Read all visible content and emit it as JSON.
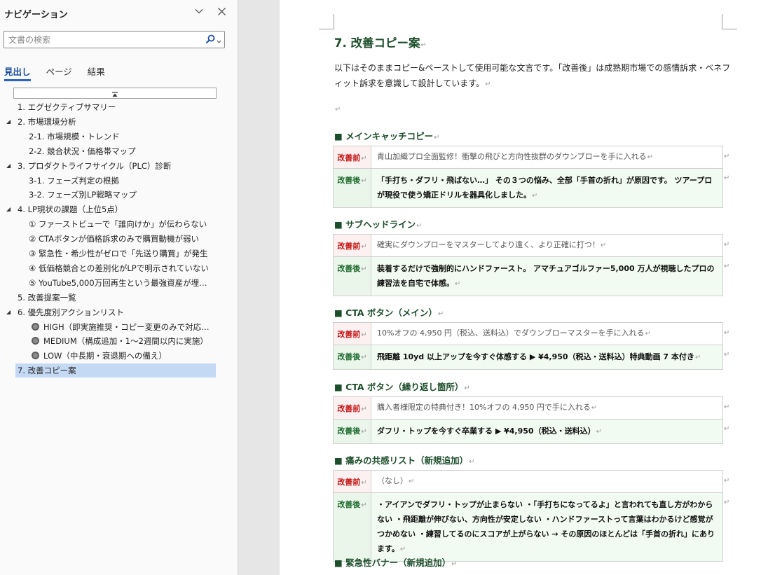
{
  "nav": {
    "title": "ナビゲーション",
    "search_placeholder": "文書の検索",
    "tabs": [
      {
        "label": "見出し",
        "active": true
      },
      {
        "label": "ページ",
        "active": false
      },
      {
        "label": "結果",
        "active": false
      }
    ],
    "outline": [
      {
        "text": "1. エグゼクティブサマリー",
        "level": 1,
        "expand": false
      },
      {
        "text": "2. 市場環境分析",
        "level": 1,
        "expand": true
      },
      {
        "text": "2-1. 市場規模・トレンド",
        "level": 2,
        "expand": false
      },
      {
        "text": "2-2. 競合状況・価格帯マップ",
        "level": 2,
        "expand": false
      },
      {
        "text": "3. プロダクトライフサイクル（PLC）診断",
        "level": 1,
        "expand": true
      },
      {
        "text": "3-1. フェーズ判定の根拠",
        "level": 2,
        "expand": false
      },
      {
        "text": "3-2. フェーズ別LP戦略マップ",
        "level": 2,
        "expand": false
      },
      {
        "text": "4. LP現状の課題（上位5点）",
        "level": 1,
        "expand": true
      },
      {
        "text": "① ファーストビューで「誰向けか」が伝わらない",
        "level": 2,
        "expand": false
      },
      {
        "text": "② CTAボタンが価格訴求のみで購買動機が弱い",
        "level": 2,
        "expand": false
      },
      {
        "text": "③ 緊急性・希少性がゼロで「先送り購買」が発生",
        "level": 2,
        "expand": false
      },
      {
        "text": "④ 低価格競合との差別化がLPで明示されていない",
        "level": 2,
        "expand": false
      },
      {
        "text": "⑤ YouTube5,000万回再生という最強資産が埋も…",
        "level": 2,
        "expand": false
      },
      {
        "text": "5. 改善提案一覧",
        "level": 1,
        "expand": false
      },
      {
        "text": "6. 優先度別アクションリスト",
        "level": 1,
        "expand": true
      },
      {
        "text": "HIGH（即実施推奨・コピー変更のみで対応可…",
        "level": 2,
        "expand": false,
        "bullet": true
      },
      {
        "text": "MEDIUM（構成追加・1〜2週間以内に実施）",
        "level": 2,
        "expand": false,
        "bullet": true
      },
      {
        "text": "LOW（中長期・衰退期への備え）",
        "level": 2,
        "expand": false,
        "bullet": true
      },
      {
        "text": "7. 改善コピー案",
        "level": 1,
        "expand": false,
        "selected": true
      }
    ]
  },
  "doc": {
    "heading": "7. 改善コピー案",
    "intro": "以下はそのままコピー&ペーストして使用可能な文言です。「改善後」は成熟期市場での感情訴求・ベネフィット訴求を意識して設計しています。",
    "before_label": "改善前",
    "after_label": "改善後",
    "sections": [
      {
        "title": "■ メインキャッチコピー",
        "before": "青山加織プロ全面監修！衝撃の飛びと方向性抜群のダウンブローを手に入れる",
        "after": "「手打ち・ダフリ・飛ばない…」 その３つの悩み、全部「手首の折れ」が原因です。 ツアープロが現役で使う矯正ドリルを器具化しました。"
      },
      {
        "title": "■ サブヘッドライン",
        "before": "確実にダウンブローをマスターしてより遠く、より正確に打つ！",
        "after": "装着するだけで強制的にハンドファースト。 アマチュアゴルファー5,000 万人が視聴したプロの練習法を自宅で体感。"
      },
      {
        "title": "■ CTA ボタン（メイン）",
        "before": "10%オフの 4,950 円（税込、送料込）でダウンブローマスターを手に入れる",
        "after": "飛距離 10yd 以上アップを今すぐ体感する ▶ ¥4,950（税込・送料込）特典動画 7 本付き"
      },
      {
        "title": "■ CTA ボタン（繰り返し箇所）",
        "before": "購入者様限定の特典付き！10%オフの 4,950 円で手に入れる",
        "after": "ダフリ・トップを今すぐ卒業する ▶ ¥4,950（税込・送料込）"
      },
      {
        "title": "■ 痛みの共感リスト（新規追加）",
        "before": "（なし）",
        "after": "・アイアンでダフリ・トップが止まらない ・「手打ちになってるよ」と言われても直し方がわからない ・飛距離が伸びない、方向性が安定しない ・ハンドファーストって言葉はわかるけど感覚がつかめない ・練習してるのにスコアが上がらない → その原因のほとんどは「手首の折れ」にあります。"
      },
      {
        "title": "■ 緊急性バナー（新規追加）"
      }
    ]
  }
}
